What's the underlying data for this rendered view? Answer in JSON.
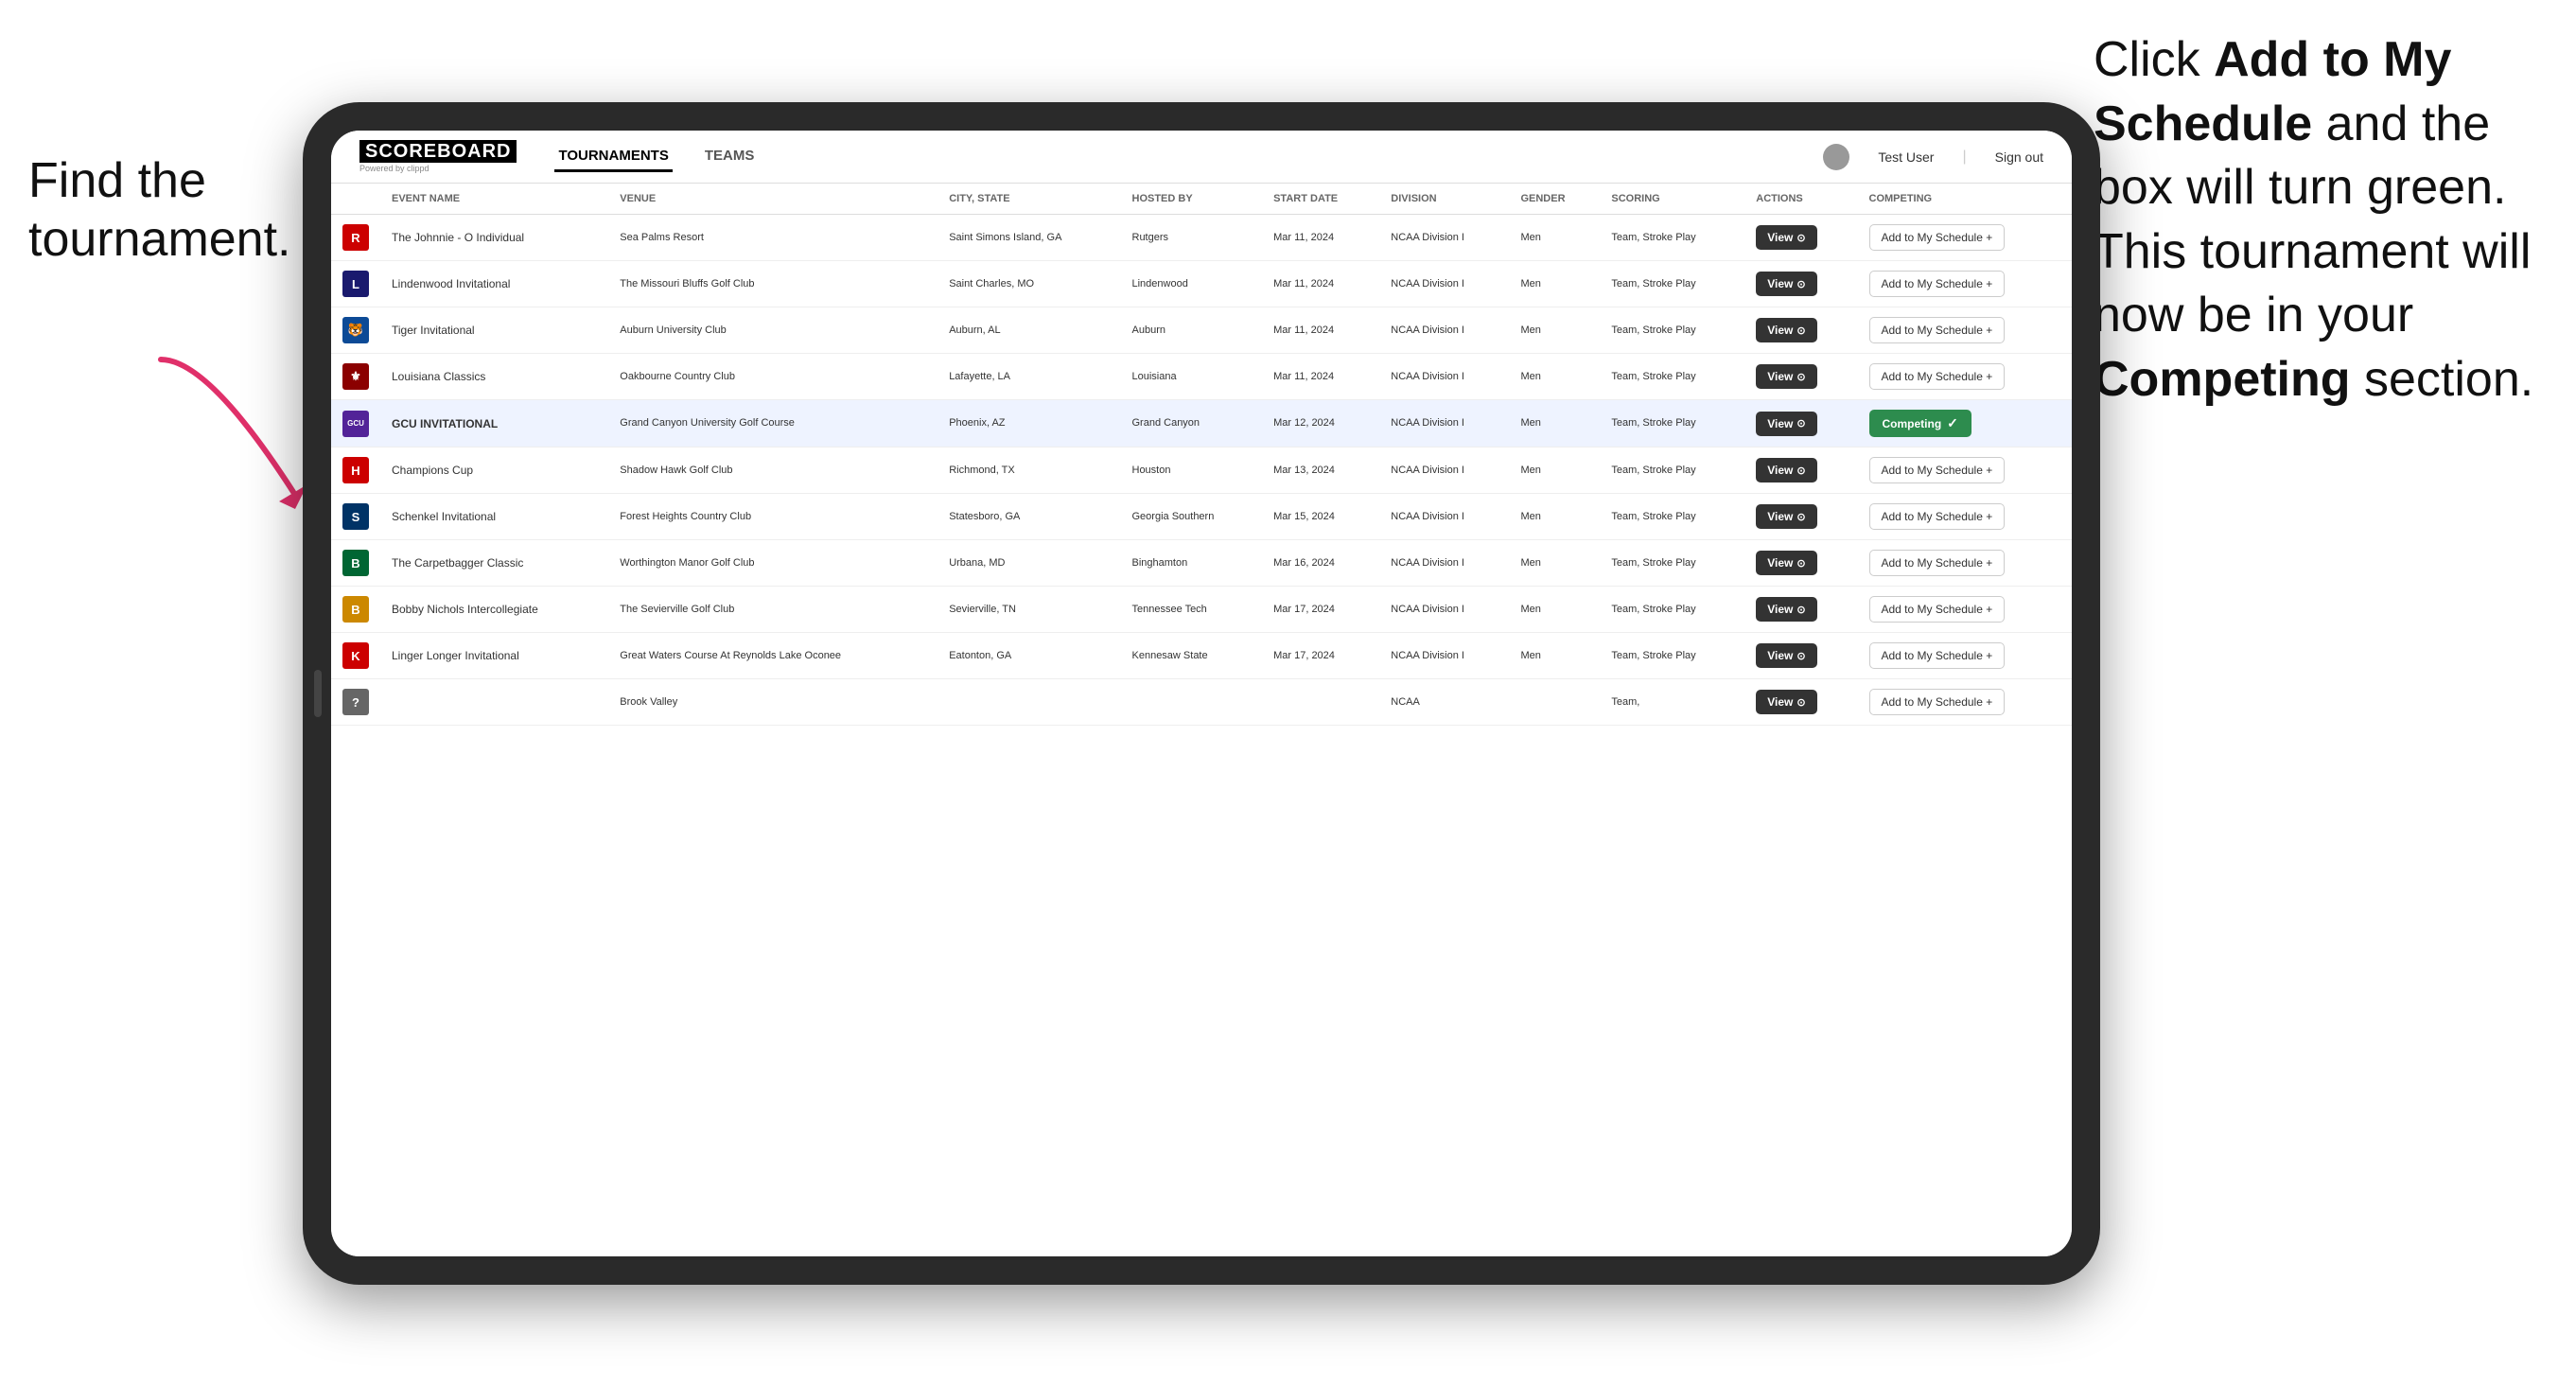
{
  "annotations": {
    "left": "Find the\ntournament.",
    "right_line1": "Click ",
    "right_bold1": "Add to My\nSchedule",
    "right_line2": " and the\nbox will turn green.\nThis tournament\nwill now be in\nyour ",
    "right_bold2": "Competing",
    "right_line3": "\nsection."
  },
  "navbar": {
    "logo": "SCOREBOARD",
    "powered_by": "Powered by clippd",
    "tabs": [
      "TOURNAMENTS",
      "TEAMS"
    ],
    "active_tab": "TOURNAMENTS",
    "user": "Test User",
    "signout": "Sign out"
  },
  "table": {
    "columns": [
      "EVENT NAME",
      "VENUE",
      "CITY, STATE",
      "HOSTED BY",
      "START DATE",
      "DIVISION",
      "GENDER",
      "SCORING",
      "ACTIONS",
      "COMPETING"
    ],
    "rows": [
      {
        "logo_color": "#cc0000",
        "logo_text": "R",
        "event": "The Johnnie - O Individual",
        "venue": "Sea Palms Resort",
        "city": "Saint Simons Island, GA",
        "hosted_by": "Rutgers",
        "start_date": "Mar 11, 2024",
        "division": "NCAA Division I",
        "gender": "Men",
        "scoring": "Team, Stroke Play",
        "action": "View",
        "competing_type": "add",
        "competing_label": "Add to My Schedule +"
      },
      {
        "logo_color": "#1a1a6e",
        "logo_text": "L",
        "event": "Lindenwood Invitational",
        "venue": "The Missouri Bluffs Golf Club",
        "city": "Saint Charles, MO",
        "hosted_by": "Lindenwood",
        "start_date": "Mar 11, 2024",
        "division": "NCAA Division I",
        "gender": "Men",
        "scoring": "Team, Stroke Play",
        "action": "View",
        "competing_type": "add",
        "competing_label": "Add to My Schedule +"
      },
      {
        "logo_color": "#0c4a96",
        "logo_text": "🐯",
        "event": "Tiger Invitational",
        "venue": "Auburn University Club",
        "city": "Auburn, AL",
        "hosted_by": "Auburn",
        "start_date": "Mar 11, 2024",
        "division": "NCAA Division I",
        "gender": "Men",
        "scoring": "Team, Stroke Play",
        "action": "View",
        "competing_type": "add",
        "competing_label": "Add to My Schedule +"
      },
      {
        "logo_color": "#8b0000",
        "logo_text": "⚜",
        "event": "Louisiana Classics",
        "venue": "Oakbourne Country Club",
        "city": "Lafayette, LA",
        "hosted_by": "Louisiana",
        "start_date": "Mar 11, 2024",
        "division": "NCAA Division I",
        "gender": "Men",
        "scoring": "Team, Stroke Play",
        "action": "View",
        "competing_type": "add",
        "competing_label": "Add to My Schedule +"
      },
      {
        "logo_color": "#522398",
        "logo_text": "GCU",
        "event": "GCU INVITATIONAL",
        "venue": "Grand Canyon University Golf Course",
        "city": "Phoenix, AZ",
        "hosted_by": "Grand Canyon",
        "start_date": "Mar 12, 2024",
        "division": "NCAA Division I",
        "gender": "Men",
        "scoring": "Team, Stroke Play",
        "action": "View",
        "competing_type": "competing",
        "competing_label": "Competing ✓",
        "highlighted": true
      },
      {
        "logo_color": "#cc0000",
        "logo_text": "H",
        "event": "Champions Cup",
        "venue": "Shadow Hawk Golf Club",
        "city": "Richmond, TX",
        "hosted_by": "Houston",
        "start_date": "Mar 13, 2024",
        "division": "NCAA Division I",
        "gender": "Men",
        "scoring": "Team, Stroke Play",
        "action": "View",
        "competing_type": "add",
        "competing_label": "Add to My Schedule +"
      },
      {
        "logo_color": "#003366",
        "logo_text": "S",
        "event": "Schenkel Invitational",
        "venue": "Forest Heights Country Club",
        "city": "Statesboro, GA",
        "hosted_by": "Georgia Southern",
        "start_date": "Mar 15, 2024",
        "division": "NCAA Division I",
        "gender": "Men",
        "scoring": "Team, Stroke Play",
        "action": "View",
        "competing_type": "add",
        "competing_label": "Add to My Schedule +"
      },
      {
        "logo_color": "#006633",
        "logo_text": "B",
        "event": "The Carpetbagger Classic",
        "venue": "Worthington Manor Golf Club",
        "city": "Urbana, MD",
        "hosted_by": "Binghamton",
        "start_date": "Mar 16, 2024",
        "division": "NCAA Division I",
        "gender": "Men",
        "scoring": "Team, Stroke Play",
        "action": "View",
        "competing_type": "add",
        "competing_label": "Add to My Schedule +"
      },
      {
        "logo_color": "#cc8800",
        "logo_text": "B",
        "event": "Bobby Nichols Intercollegiate",
        "venue": "The Sevierville Golf Club",
        "city": "Sevierville, TN",
        "hosted_by": "Tennessee Tech",
        "start_date": "Mar 17, 2024",
        "division": "NCAA Division I",
        "gender": "Men",
        "scoring": "Team, Stroke Play",
        "action": "View",
        "competing_type": "add",
        "competing_label": "Add to My Schedule +"
      },
      {
        "logo_color": "#cc0000",
        "logo_text": "K",
        "event": "Linger Longer Invitational",
        "venue": "Great Waters Course At Reynolds Lake Oconee",
        "city": "Eatonton, GA",
        "hosted_by": "Kennesaw State",
        "start_date": "Mar 17, 2024",
        "division": "NCAA Division I",
        "gender": "Men",
        "scoring": "Team, Stroke Play",
        "action": "View",
        "competing_type": "add",
        "competing_label": "Add to My Schedule +"
      },
      {
        "logo_color": "#666666",
        "logo_text": "?",
        "event": "",
        "venue": "Brook Valley",
        "city": "",
        "hosted_by": "",
        "start_date": "",
        "division": "NCAA",
        "gender": "",
        "scoring": "Team,",
        "action": "View",
        "competing_type": "add",
        "competing_label": "Add to My Schedule +"
      }
    ]
  }
}
